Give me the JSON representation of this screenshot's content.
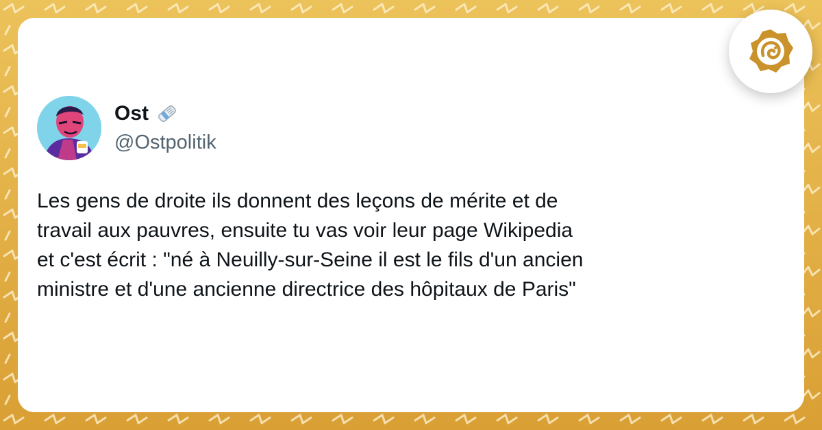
{
  "tweet": {
    "author_name": "Ost",
    "author_handle": "@Ostpolitik",
    "name_emoji_icon": "newspaper-roll-icon",
    "text_lines": [
      "Les gens de droite ils donnent des leçons de mérite et de",
      "travail aux pauvres, ensuite tu vas voir leur page Wikipedia",
      "et c'est écrit : \"né à Neuilly-sur-Seine il est le fils d'un ancien",
      "ministre et d'une ancienne directrice des hôpitaux de Paris\""
    ]
  },
  "brand": {
    "logo_icon": "gold-bird-logo-icon"
  },
  "colors": {
    "background": "#e7b84a",
    "card": "#ffffff",
    "text": "#0f1419",
    "handle": "#536471",
    "logo_gold": "#c9922a"
  }
}
